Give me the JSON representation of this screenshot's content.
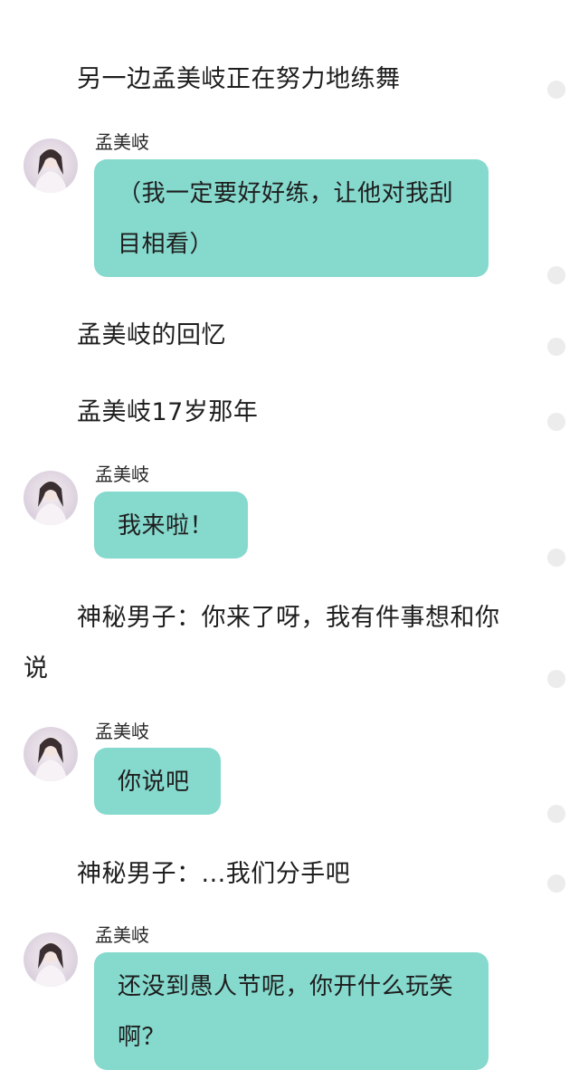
{
  "messages": [
    {
      "type": "narration",
      "text": "另一边孟美岐正在努力地练舞"
    },
    {
      "type": "chat",
      "sender": "孟美岐",
      "text": "（我一定要好好练，让他对我刮目相看）"
    },
    {
      "type": "narration",
      "text": "孟美岐的回忆"
    },
    {
      "type": "narration",
      "text": "孟美岐17岁那年"
    },
    {
      "type": "chat",
      "sender": "孟美岐",
      "text": "我来啦！"
    },
    {
      "type": "narration",
      "text": "神秘男子：你来了呀，我有件事想和你说"
    },
    {
      "type": "chat",
      "sender": "孟美岐",
      "text": "你说吧"
    },
    {
      "type": "narration",
      "text": "神秘男子：...我们分手吧"
    },
    {
      "type": "chat",
      "sender": "孟美岐",
      "text": "还没到愚人节呢，你开什么玩笑啊？"
    }
  ],
  "colors": {
    "bubble": "#86d9cd",
    "background": "#ffffff",
    "dot": "#ececec",
    "text": "#1e1e1e"
  },
  "icons": {
    "avatar": "avatar-icon",
    "dot": "dot-icon"
  }
}
